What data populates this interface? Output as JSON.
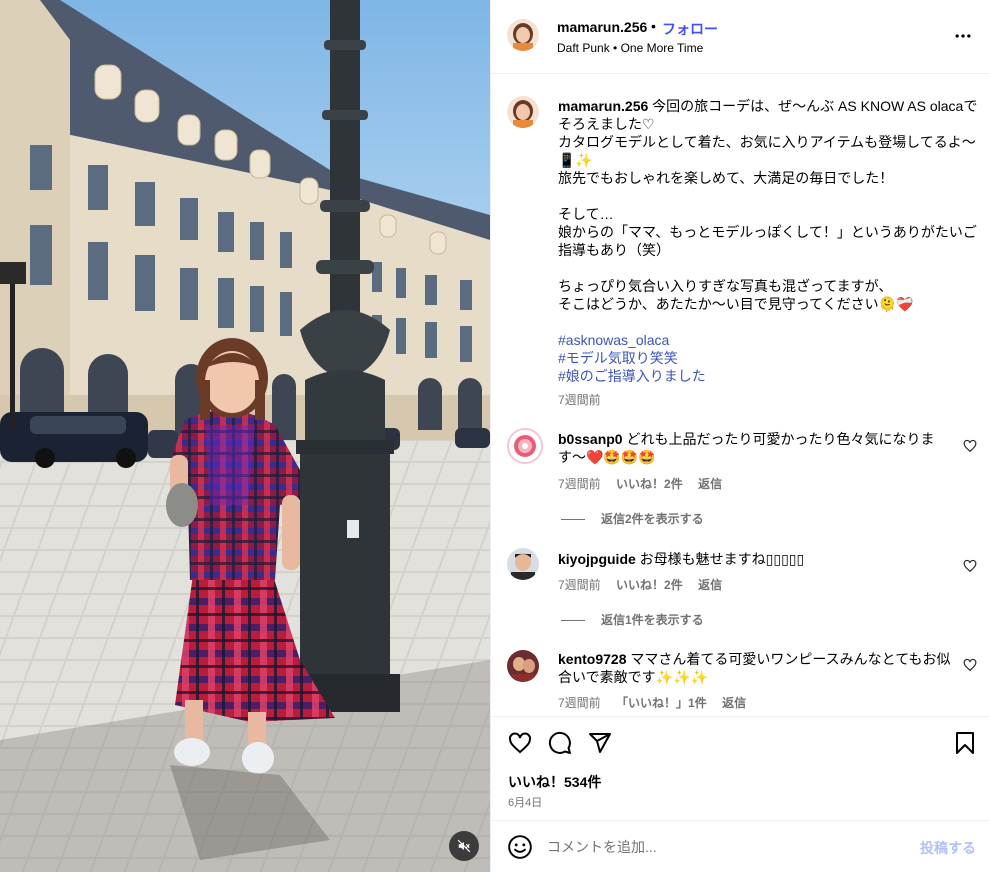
{
  "post": {
    "username": "mamarun.256",
    "follow_label": "フォロー",
    "separator": "•",
    "music": "Daft Punk • One More Time"
  },
  "caption": {
    "username": "mamarun.256",
    "lines": [
      " 今回の旅コーデは、ぜ〜んぶ AS KNOW AS olacaでそろえました♡",
      "カタログモデルとして着た、お気に入りアイテムも登場してるよ〜",
      "📱✨",
      "旅先でもおしゃれを楽しめて、大満足の毎日でした！",
      "そして…",
      "娘からの「ママ、もっとモデルっぽくして！」というありがたいご指導もあり（笑）",
      "ちょっぴり気合い入りすぎな写真も混ざってますが、",
      "そこはどうか、あたたか〜い目で見守ってください🫠❤️‍🩹"
    ],
    "hashtags": [
      "#asknowas_olaca",
      "#モデル気取り笑笑",
      "#娘のご指導入りました"
    ],
    "time": "7週間前"
  },
  "comments": [
    {
      "username": "b0ssanp0",
      "text": " どれも上品だったり可愛かったり色々気になります〜❤️🤩🤩🤩",
      "time": "7週間前",
      "likes": "いいね！2件",
      "reply": "返信",
      "view_replies": "返信2件を表示する"
    },
    {
      "username": "kiyojpguide",
      "text": " お母様も魅せますね▯▯▯▯▯",
      "time": "7週間前",
      "likes": "いいね！2件",
      "reply": "返信",
      "view_replies": "返信1件を表示する"
    },
    {
      "username": "kento9728",
      "text": " ママさん着てる可愛いワンピースみんなとてもお似合いで素敵です✨✨✨",
      "time": "7週間前",
      "likes": "「いいね！」1件",
      "reply": "返信"
    }
  ],
  "stats": {
    "likes": "いいね！534件",
    "date": "6月4日"
  },
  "comment_box": {
    "placeholder": "コメントを追加...",
    "post_label": "投稿する"
  },
  "colors": {
    "link_blue": "#4150f7",
    "hashtag_blue": "#3d55b8",
    "muted_gray": "#737373",
    "post_disabled": "#b3c2f5"
  },
  "icons": [
    "more-options-icon",
    "heart-icon",
    "comment-icon",
    "share-icon",
    "bookmark-icon",
    "emoji-icon",
    "mute-icon"
  ]
}
